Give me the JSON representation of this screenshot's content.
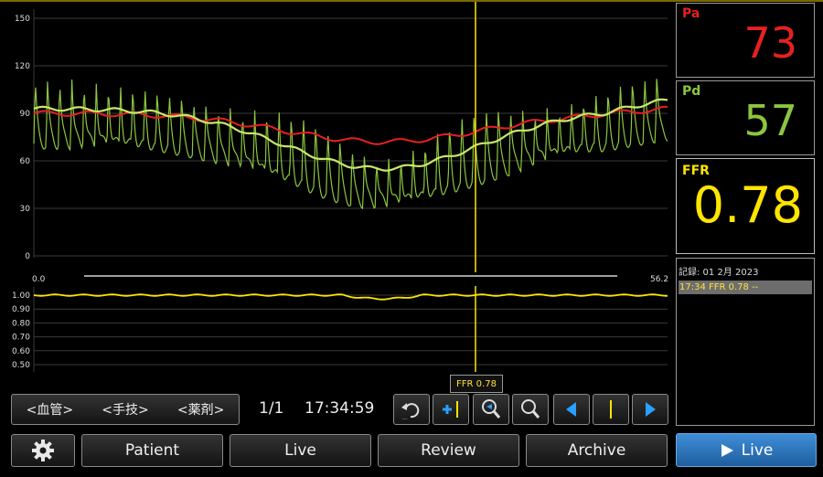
{
  "readings": {
    "pa": {
      "label": "Pa",
      "value": "73",
      "color": "#e82020"
    },
    "pd": {
      "label": "Pd",
      "value": "57",
      "color": "#8cc63f"
    },
    "ffr": {
      "label": "FFR",
      "value": "0.78",
      "color": "#ffe500"
    }
  },
  "pressure_axis": {
    "ticks": [
      "150",
      "120",
      "90",
      "60",
      "30",
      "0"
    ]
  },
  "ratio_axis": {
    "ticks": [
      "1.00",
      "0.90",
      "0.80",
      "0.70",
      "0.60",
      "0.50"
    ]
  },
  "time_range": {
    "start": "0.0",
    "end": "56.2"
  },
  "record_log": {
    "header": "記録:   01 2月 2023",
    "entries": [
      {
        "text": "17:34      FFR  0.78 --"
      }
    ]
  },
  "cursor_tooltip": "FFR 0.78",
  "selectors": {
    "vessel": "<血管>",
    "procedure": "<手技>",
    "drug": "<薬剤>"
  },
  "page_indicator": "1/1",
  "timestamp": "17:34:59",
  "nav": {
    "patient": "Patient",
    "live": "Live",
    "review": "Review",
    "archive": "Archive",
    "live_main": "Live"
  },
  "toolbar_icons": [
    "undo-icon",
    "add-marker-icon",
    "zoom-in-icon",
    "zoom-out-icon",
    "step-left-icon",
    "cursor-marker-icon",
    "step-right-icon"
  ],
  "gear_icon": "gear-icon"
}
